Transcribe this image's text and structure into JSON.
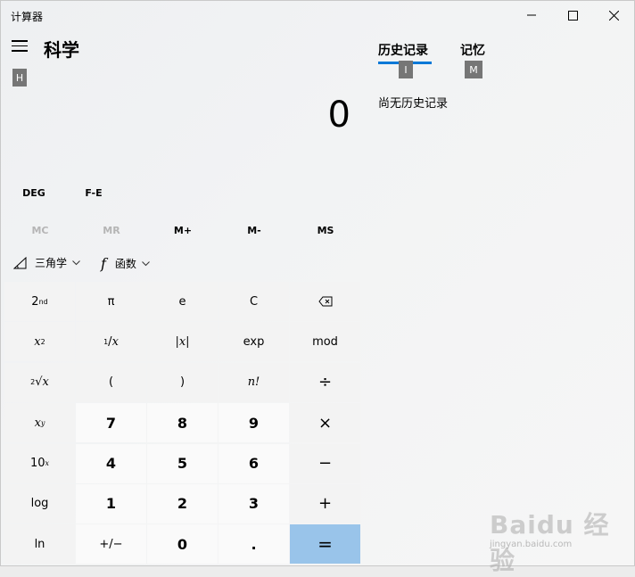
{
  "window": {
    "title": "计算器"
  },
  "header": {
    "menu_icon": "hamburger-icon",
    "mode": "科学",
    "hint_nav": "H"
  },
  "display": {
    "value": "0"
  },
  "side_panel": {
    "tabs": [
      {
        "label": "历史记录",
        "hint": "I",
        "selected": true
      },
      {
        "label": "记忆",
        "hint": "M",
        "selected": false
      }
    ],
    "empty_text": "尚无历史记录",
    "accent": "#0078d7"
  },
  "angle_row": {
    "deg": "DEG",
    "fe": "F-E"
  },
  "memory_row": [
    "MC",
    "MR",
    "M+",
    "M-",
    "MS"
  ],
  "func_row": {
    "trig_label": "三角学",
    "func_label": "函数"
  },
  "keys": {
    "pi": "π",
    "e": "e",
    "clear": "C",
    "abs": "|x|",
    "exp": "exp",
    "mod": "mod",
    "lparen": "(",
    "rparen": ")",
    "fact": "n!",
    "div": "÷",
    "d7": "7",
    "d8": "8",
    "d9": "9",
    "mul": "×",
    "d4": "4",
    "d5": "5",
    "d6": "6",
    "sub": "−",
    "log": "log",
    "d1": "1",
    "d2": "2",
    "d3": "3",
    "add": "+",
    "ln": "ln",
    "negate": "+/−",
    "d0": "0",
    "dot": ".",
    "eq": "="
  },
  "watermark": {
    "main": "Baidu 经验",
    "sub": "jingyan.baidu.com"
  }
}
